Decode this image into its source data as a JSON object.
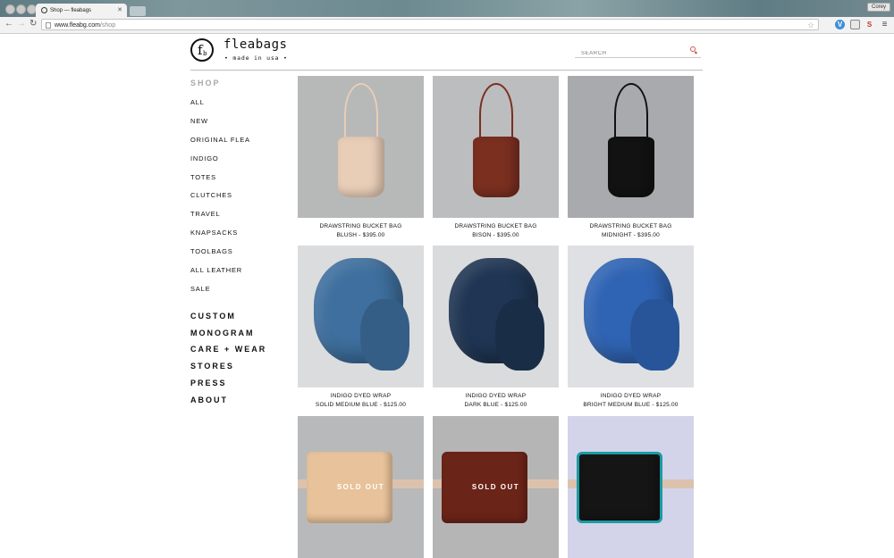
{
  "browser": {
    "tab_title": "Shop — fleabags",
    "url_host": "www.fleabg.com",
    "url_path": "/shop",
    "user": "Corey"
  },
  "brand": {
    "name": "fleabags",
    "tagline": "• made in usa •",
    "logo_letter": "f",
    "logo_sub": "b"
  },
  "search": {
    "placeholder": "SEARCH"
  },
  "sidebar": {
    "heading": "SHOP",
    "categories": [
      "ALL",
      "NEW",
      "ORIGINAL FLEA",
      "INDIGO",
      "TOTES",
      "CLUTCHES",
      "TRAVEL",
      "KNAPSACKS",
      "TOOLBAGS",
      "ALL LEATHER",
      "SALE"
    ],
    "links": [
      "CUSTOM",
      "MONOGRAM",
      "CARE + WEAR",
      "STORES",
      "PRESS",
      "ABOUT"
    ]
  },
  "products": [
    {
      "name": "DRAWSTRING BUCKET BAG",
      "variant": "BLUSH - $395.00",
      "kind": "bucket",
      "bg": "#b7b8b8",
      "color": "#e8cdb7"
    },
    {
      "name": "DRAWSTRING BUCKET BAG",
      "variant": "BISON - $395.00",
      "kind": "bucket",
      "bg": "#bcbdbf",
      "color": "#7a2f1f"
    },
    {
      "name": "DRAWSTRING BUCKET BAG",
      "variant": "MIDNIGHT - $395.00",
      "kind": "bucket",
      "bg": "#a9aaad",
      "color": "#121212"
    },
    {
      "name": "INDIGO DYED WRAP",
      "variant": "SOLID MEDIUM BLUE - $125.00",
      "kind": "scarf",
      "bg": "#dadcde",
      "color": "#3e6f9e"
    },
    {
      "name": "INDIGO DYED WRAP",
      "variant": "DARK BLUE - $125.00",
      "kind": "scarf",
      "bg": "#d9dbdd",
      "color": "#1f3553"
    },
    {
      "name": "INDIGO DYED WRAP",
      "variant": "BRIGHT MEDIUM BLUE - $125.00",
      "kind": "scarf",
      "bg": "#dee0e3",
      "color": "#2f64b4"
    },
    {
      "name": "",
      "variant": "",
      "kind": "wallet",
      "bg": "#b8b9ba",
      "color": "#e8c29a",
      "sold_out": "SOLD OUT"
    },
    {
      "name": "",
      "variant": "",
      "kind": "wallet",
      "bg": "#b5b5b6",
      "color": "#6b2418",
      "sold_out": "SOLD OUT"
    },
    {
      "name": "",
      "variant": "",
      "kind": "wallet",
      "bg": "#d3d4ea",
      "color": "#151515",
      "trim": "#1b9aa3"
    }
  ]
}
